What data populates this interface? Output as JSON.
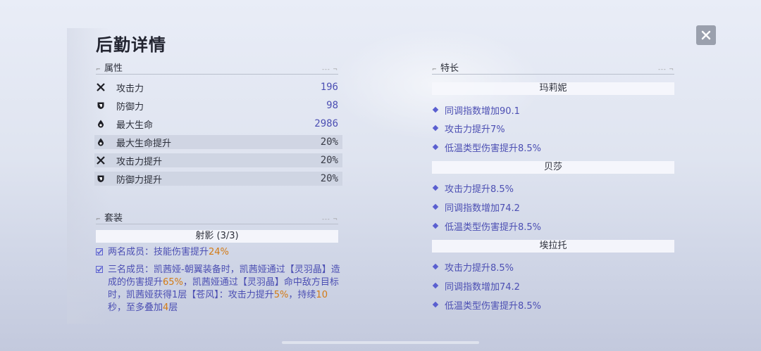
{
  "title": "后勤详情",
  "attributes_header": "属性",
  "attributes": [
    {
      "icon": "sword-cross-icon",
      "name": "攻击力",
      "value": "196",
      "color": "#4c4fb3"
    },
    {
      "icon": "shield-icon",
      "name": "防御力",
      "value": "98",
      "color": "#4c4fb3"
    },
    {
      "icon": "drop-icon",
      "name": "最大生命",
      "value": "2986",
      "color": "#4c4fb3"
    },
    {
      "icon": "drop-icon",
      "name": "最大生命提升",
      "value": "20%",
      "color": "#3a3d48"
    },
    {
      "icon": "sword-cross-icon",
      "name": "攻击力提升",
      "value": "20%",
      "color": "#3a3d48"
    },
    {
      "icon": "shield-icon",
      "name": "防御力提升",
      "value": "20%",
      "color": "#3a3d48"
    }
  ],
  "set_header": "套装",
  "set": {
    "title": "射影  (3/3)",
    "effects": [
      {
        "parts": [
          "两名成员：技能伤害提升",
          "24%"
        ]
      },
      {
        "parts": [
          "三名成员：凯茜娅-朝翼装备时，凯茜娅通过【灵羽晶】造成的伤害提升",
          "65%",
          "，凯茜娅通过【灵羽晶】命中敌方目标时，凯茜娅获得1层【苍风】：攻击力提升",
          "5%",
          "，持续",
          "10",
          "秒，至多叠加",
          "4",
          "层"
        ]
      }
    ]
  },
  "traits_header": "特长",
  "characters": [
    {
      "name": "玛莉妮",
      "traits": [
        "同调指数增加90.1",
        "攻击力提升7%",
        "低温类型伤害提升8.5%"
      ]
    },
    {
      "name": "贝莎",
      "traits": [
        "攻击力提升8.5%",
        "同调指数增加74.2",
        "低温类型伤害提升8.5%"
      ]
    },
    {
      "name": "埃拉托",
      "traits": [
        "攻击力提升8.5%",
        "同调指数增加74.2",
        "低温类型伤害提升8.5%"
      ]
    }
  ],
  "colors": {
    "accent": "#4c4fb3",
    "highlight": "#d37a14",
    "close_bg": "#9aa0ad"
  }
}
